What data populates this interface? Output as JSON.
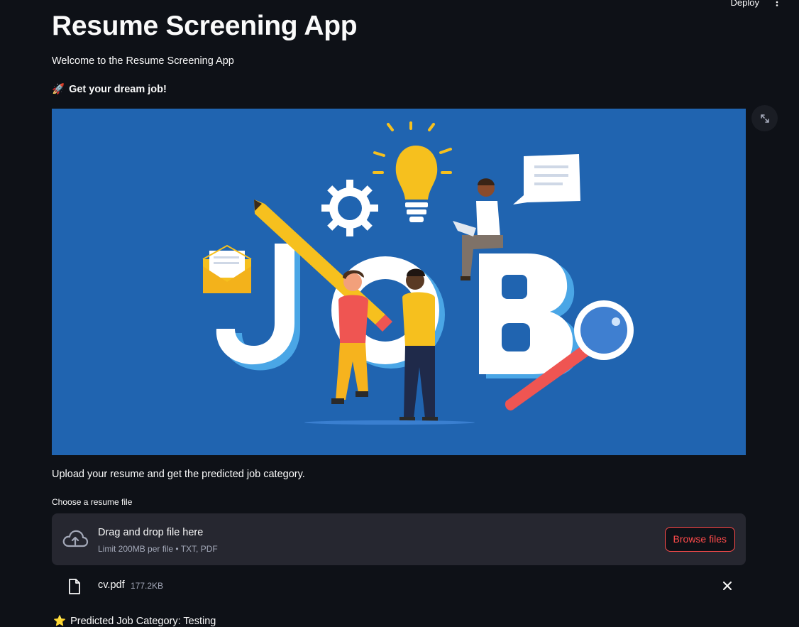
{
  "header": {
    "deploy_label": "Deploy",
    "menu_icon": "more-vertical-icon"
  },
  "app": {
    "title": "Resume Screening App",
    "welcome": "Welcome to the Resume Screening App",
    "tagline_emoji": "🚀",
    "tagline": "Get your dream job!",
    "hero_image": {
      "word": "JOB",
      "background": "#2064b0",
      "icons": [
        "pencil-icon",
        "gear-icon",
        "lightbulb-icon",
        "envelope-icon",
        "speech-bubble-icon",
        "magnifying-glass-icon"
      ]
    },
    "upload_instructions": "Upload your resume and get the predicted job category."
  },
  "uploader": {
    "label": "Choose a resume file",
    "drop_text": "Drag and drop file here",
    "limit_text": "Limit 200MB per file • TXT, PDF",
    "browse_label": "Browse files",
    "uploaded_file": {
      "name": "cv.pdf",
      "size": "177.2KB"
    }
  },
  "result": {
    "emoji": "⭐",
    "text": "Predicted Job Category: Testing"
  },
  "colors": {
    "background": "#0e1117",
    "panel": "#262730",
    "accent": "#ff4b4b",
    "text": "#fafafa",
    "muted": "#a3a8b8"
  }
}
